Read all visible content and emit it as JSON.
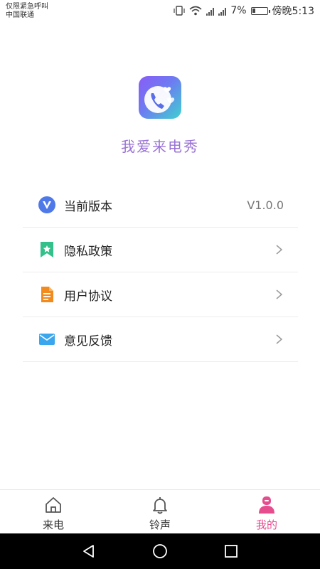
{
  "status_bar": {
    "line1": "仅限紧急呼叫",
    "line2": "中国联通",
    "battery": "7%",
    "time": "傍晚5:13"
  },
  "app": {
    "name": "我爱来电秀"
  },
  "menu": [
    {
      "label": "当前版本",
      "value": "V1.0.0",
      "icon": "version-v-icon"
    },
    {
      "label": "隐私政策",
      "icon": "bookmark-star-icon"
    },
    {
      "label": "用户协议",
      "icon": "document-icon"
    },
    {
      "label": "意见反馈",
      "icon": "mail-icon"
    }
  ],
  "tabs": [
    {
      "label": "来电",
      "icon": "home-icon"
    },
    {
      "label": "铃声",
      "icon": "bell-icon"
    },
    {
      "label": "我的",
      "icon": "profile-icon"
    }
  ],
  "colors": {
    "accent_pink": "#e64d8f",
    "app_name": "#9a73d6"
  }
}
